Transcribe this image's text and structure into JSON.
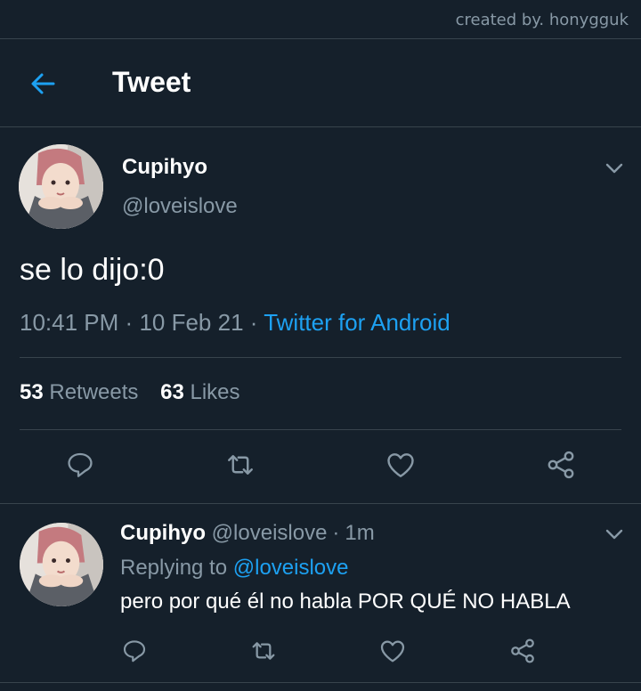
{
  "credit": "created by. honygguk",
  "header": {
    "back_icon": "arrow-left-icon",
    "title": "Tweet"
  },
  "colors": {
    "background": "#15202b",
    "accent": "#1da1f2",
    "secondary_text": "#8899a6",
    "divider": "#38444d"
  },
  "tweet": {
    "name": "Cupihyo",
    "handle": "@loveislove",
    "text": "se lo dijo:0",
    "time": "10:41 PM",
    "date": "10 Feb 21",
    "separator": "·",
    "source": "Twitter for Android",
    "retweets_count": "53",
    "retweets_label": "Retweets",
    "likes_count": "63",
    "likes_label": "Likes",
    "actions": [
      "reply-icon",
      "retweet-icon",
      "like-icon",
      "share-icon"
    ]
  },
  "reply": {
    "name": "Cupihyo",
    "handle": "@loveislove",
    "separator": "·",
    "time": "1m",
    "replying_prefix": "Replying to",
    "replying_to": "@loveislove",
    "text": "pero por qué él no habla POR QUÉ NO HABLA",
    "actions": [
      "reply-icon",
      "retweet-icon",
      "like-icon",
      "share-icon"
    ]
  }
}
